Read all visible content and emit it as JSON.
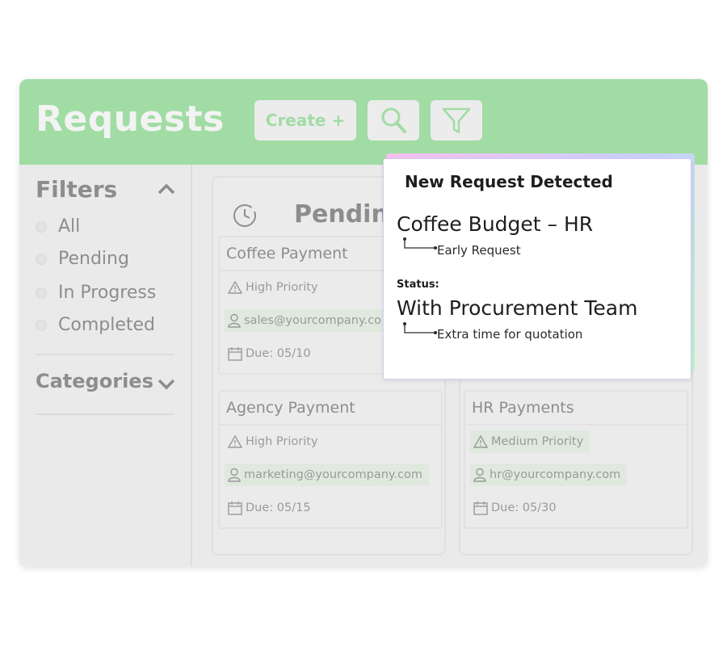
{
  "header": {
    "title": "Requests",
    "create_label": "Create +",
    "search_icon": "search-icon",
    "filter_icon": "funnel-icon"
  },
  "sidebar": {
    "filters_title": "Filters",
    "options": [
      "All",
      "Pending",
      "In Progress",
      "Completed"
    ],
    "categories_title": "Categories"
  },
  "board": {
    "column_title": "Pendin",
    "cards": [
      {
        "title": "Coffee Payment",
        "priority": "High Priority",
        "email": "sales@yourcompany.co",
        "due": "Due: 05/10"
      },
      {
        "title": "Agency Payment",
        "priority": "High Priority",
        "email": "marketing@yourcompany.com",
        "due": "Due: 05/15"
      },
      {
        "title": "HR Payments",
        "priority": "Medium Priority",
        "email": "hr@yourcompany.com",
        "due": "Due: 05/30"
      }
    ]
  },
  "popup": {
    "title": "New Request Detected",
    "request_name": "Coffee Budget – HR",
    "request_note": "Early Request",
    "status_label": "Status:",
    "status_value": "With Procurement Team",
    "status_note": "Extra time for quotation"
  },
  "colors": {
    "header_green": "#a1dca4",
    "tag_green": "#dfe9de",
    "panel_gray": "#eaeaea"
  }
}
